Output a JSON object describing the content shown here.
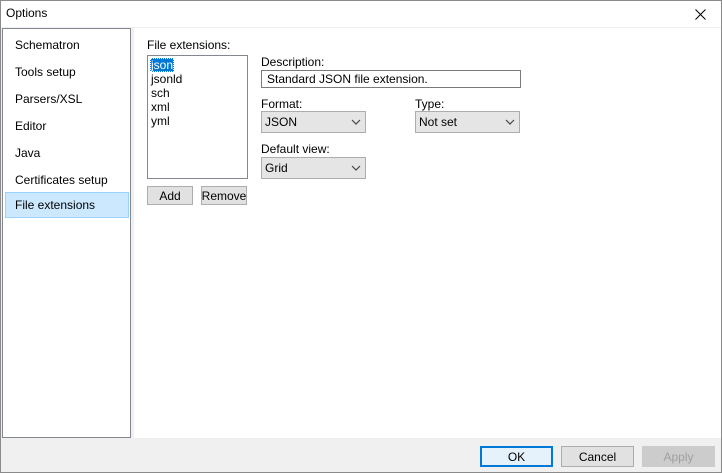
{
  "window": {
    "title": "Options",
    "close_icon": "close-icon"
  },
  "sidebar": {
    "items": [
      {
        "label": "Schematron"
      },
      {
        "label": "Tools setup"
      },
      {
        "label": "Parsers/XSL"
      },
      {
        "label": "Editor"
      },
      {
        "label": "Java"
      },
      {
        "label": "Certificates setup"
      },
      {
        "label": "File extensions",
        "selected": true
      }
    ]
  },
  "file_extensions": {
    "label": "File extensions:",
    "items": [
      "json",
      "jsonld",
      "sch",
      "xml",
      "yml"
    ],
    "selected": "json",
    "add_label": "Add",
    "remove_label": "Remove"
  },
  "details": {
    "description_label": "Description:",
    "description_value": "Standard JSON file extension.",
    "format_label": "Format:",
    "format_value": "JSON",
    "type_label": "Type:",
    "type_value": "Not set",
    "default_view_label": "Default view:",
    "default_view_value": "Grid"
  },
  "footer": {
    "ok_label": "OK",
    "cancel_label": "Cancel",
    "apply_label": "Apply"
  },
  "colors": {
    "selection": "#0078d7",
    "sidebar_selected": "#cce8ff"
  }
}
